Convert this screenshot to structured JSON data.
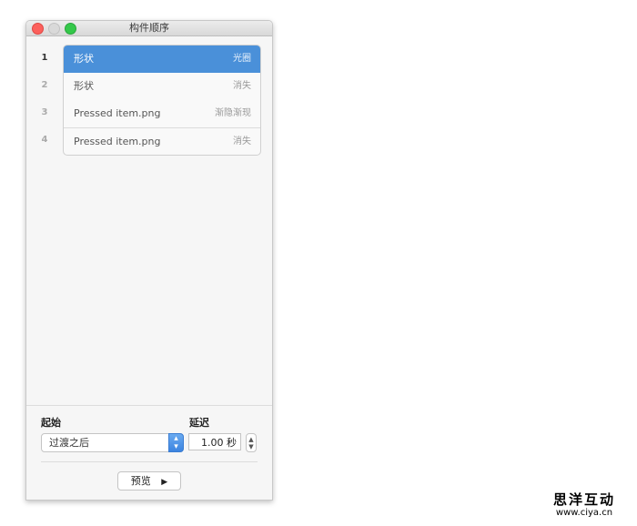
{
  "window": {
    "title": "构件顺序"
  },
  "rows": [
    {
      "num": "1",
      "name": "形状",
      "effect": "光圈",
      "selected": true
    },
    {
      "num": "2",
      "name": "形状",
      "effect": "消失"
    },
    {
      "num": "3",
      "name": "Pressed item.png",
      "effect": "渐隐渐现"
    },
    {
      "num": "4",
      "name": "Pressed item.png",
      "effect": "消失"
    }
  ],
  "start": {
    "label": "起始",
    "value": "过渡之后"
  },
  "delay": {
    "label": "延迟",
    "value": "1.00 秒"
  },
  "preview": {
    "label": "预览",
    "icon": "play-icon"
  },
  "watermark": {
    "name": "思洋互动",
    "url": "www.ciya.cn"
  }
}
